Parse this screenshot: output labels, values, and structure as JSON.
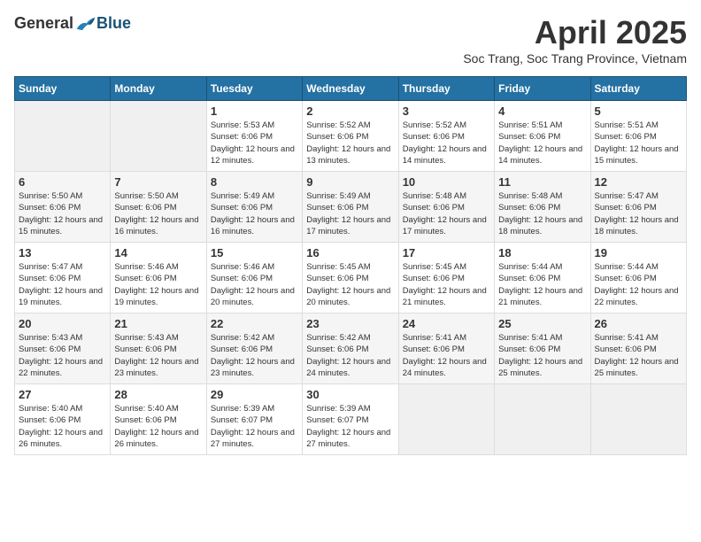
{
  "header": {
    "logo_general": "General",
    "logo_blue": "Blue",
    "month": "April 2025",
    "subtitle": "Soc Trang, Soc Trang Province, Vietnam"
  },
  "weekdays": [
    "Sunday",
    "Monday",
    "Tuesday",
    "Wednesday",
    "Thursday",
    "Friday",
    "Saturday"
  ],
  "weeks": [
    [
      {
        "day": "",
        "info": ""
      },
      {
        "day": "",
        "info": ""
      },
      {
        "day": "1",
        "info": "Sunrise: 5:53 AM\nSunset: 6:06 PM\nDaylight: 12 hours and 12 minutes."
      },
      {
        "day": "2",
        "info": "Sunrise: 5:52 AM\nSunset: 6:06 PM\nDaylight: 12 hours and 13 minutes."
      },
      {
        "day": "3",
        "info": "Sunrise: 5:52 AM\nSunset: 6:06 PM\nDaylight: 12 hours and 14 minutes."
      },
      {
        "day": "4",
        "info": "Sunrise: 5:51 AM\nSunset: 6:06 PM\nDaylight: 12 hours and 14 minutes."
      },
      {
        "day": "5",
        "info": "Sunrise: 5:51 AM\nSunset: 6:06 PM\nDaylight: 12 hours and 15 minutes."
      }
    ],
    [
      {
        "day": "6",
        "info": "Sunrise: 5:50 AM\nSunset: 6:06 PM\nDaylight: 12 hours and 15 minutes."
      },
      {
        "day": "7",
        "info": "Sunrise: 5:50 AM\nSunset: 6:06 PM\nDaylight: 12 hours and 16 minutes."
      },
      {
        "day": "8",
        "info": "Sunrise: 5:49 AM\nSunset: 6:06 PM\nDaylight: 12 hours and 16 minutes."
      },
      {
        "day": "9",
        "info": "Sunrise: 5:49 AM\nSunset: 6:06 PM\nDaylight: 12 hours and 17 minutes."
      },
      {
        "day": "10",
        "info": "Sunrise: 5:48 AM\nSunset: 6:06 PM\nDaylight: 12 hours and 17 minutes."
      },
      {
        "day": "11",
        "info": "Sunrise: 5:48 AM\nSunset: 6:06 PM\nDaylight: 12 hours and 18 minutes."
      },
      {
        "day": "12",
        "info": "Sunrise: 5:47 AM\nSunset: 6:06 PM\nDaylight: 12 hours and 18 minutes."
      }
    ],
    [
      {
        "day": "13",
        "info": "Sunrise: 5:47 AM\nSunset: 6:06 PM\nDaylight: 12 hours and 19 minutes."
      },
      {
        "day": "14",
        "info": "Sunrise: 5:46 AM\nSunset: 6:06 PM\nDaylight: 12 hours and 19 minutes."
      },
      {
        "day": "15",
        "info": "Sunrise: 5:46 AM\nSunset: 6:06 PM\nDaylight: 12 hours and 20 minutes."
      },
      {
        "day": "16",
        "info": "Sunrise: 5:45 AM\nSunset: 6:06 PM\nDaylight: 12 hours and 20 minutes."
      },
      {
        "day": "17",
        "info": "Sunrise: 5:45 AM\nSunset: 6:06 PM\nDaylight: 12 hours and 21 minutes."
      },
      {
        "day": "18",
        "info": "Sunrise: 5:44 AM\nSunset: 6:06 PM\nDaylight: 12 hours and 21 minutes."
      },
      {
        "day": "19",
        "info": "Sunrise: 5:44 AM\nSunset: 6:06 PM\nDaylight: 12 hours and 22 minutes."
      }
    ],
    [
      {
        "day": "20",
        "info": "Sunrise: 5:43 AM\nSunset: 6:06 PM\nDaylight: 12 hours and 22 minutes."
      },
      {
        "day": "21",
        "info": "Sunrise: 5:43 AM\nSunset: 6:06 PM\nDaylight: 12 hours and 23 minutes."
      },
      {
        "day": "22",
        "info": "Sunrise: 5:42 AM\nSunset: 6:06 PM\nDaylight: 12 hours and 23 minutes."
      },
      {
        "day": "23",
        "info": "Sunrise: 5:42 AM\nSunset: 6:06 PM\nDaylight: 12 hours and 24 minutes."
      },
      {
        "day": "24",
        "info": "Sunrise: 5:41 AM\nSunset: 6:06 PM\nDaylight: 12 hours and 24 minutes."
      },
      {
        "day": "25",
        "info": "Sunrise: 5:41 AM\nSunset: 6:06 PM\nDaylight: 12 hours and 25 minutes."
      },
      {
        "day": "26",
        "info": "Sunrise: 5:41 AM\nSunset: 6:06 PM\nDaylight: 12 hours and 25 minutes."
      }
    ],
    [
      {
        "day": "27",
        "info": "Sunrise: 5:40 AM\nSunset: 6:06 PM\nDaylight: 12 hours and 26 minutes."
      },
      {
        "day": "28",
        "info": "Sunrise: 5:40 AM\nSunset: 6:06 PM\nDaylight: 12 hours and 26 minutes."
      },
      {
        "day": "29",
        "info": "Sunrise: 5:39 AM\nSunset: 6:07 PM\nDaylight: 12 hours and 27 minutes."
      },
      {
        "day": "30",
        "info": "Sunrise: 5:39 AM\nSunset: 6:07 PM\nDaylight: 12 hours and 27 minutes."
      },
      {
        "day": "",
        "info": ""
      },
      {
        "day": "",
        "info": ""
      },
      {
        "day": "",
        "info": ""
      }
    ]
  ]
}
